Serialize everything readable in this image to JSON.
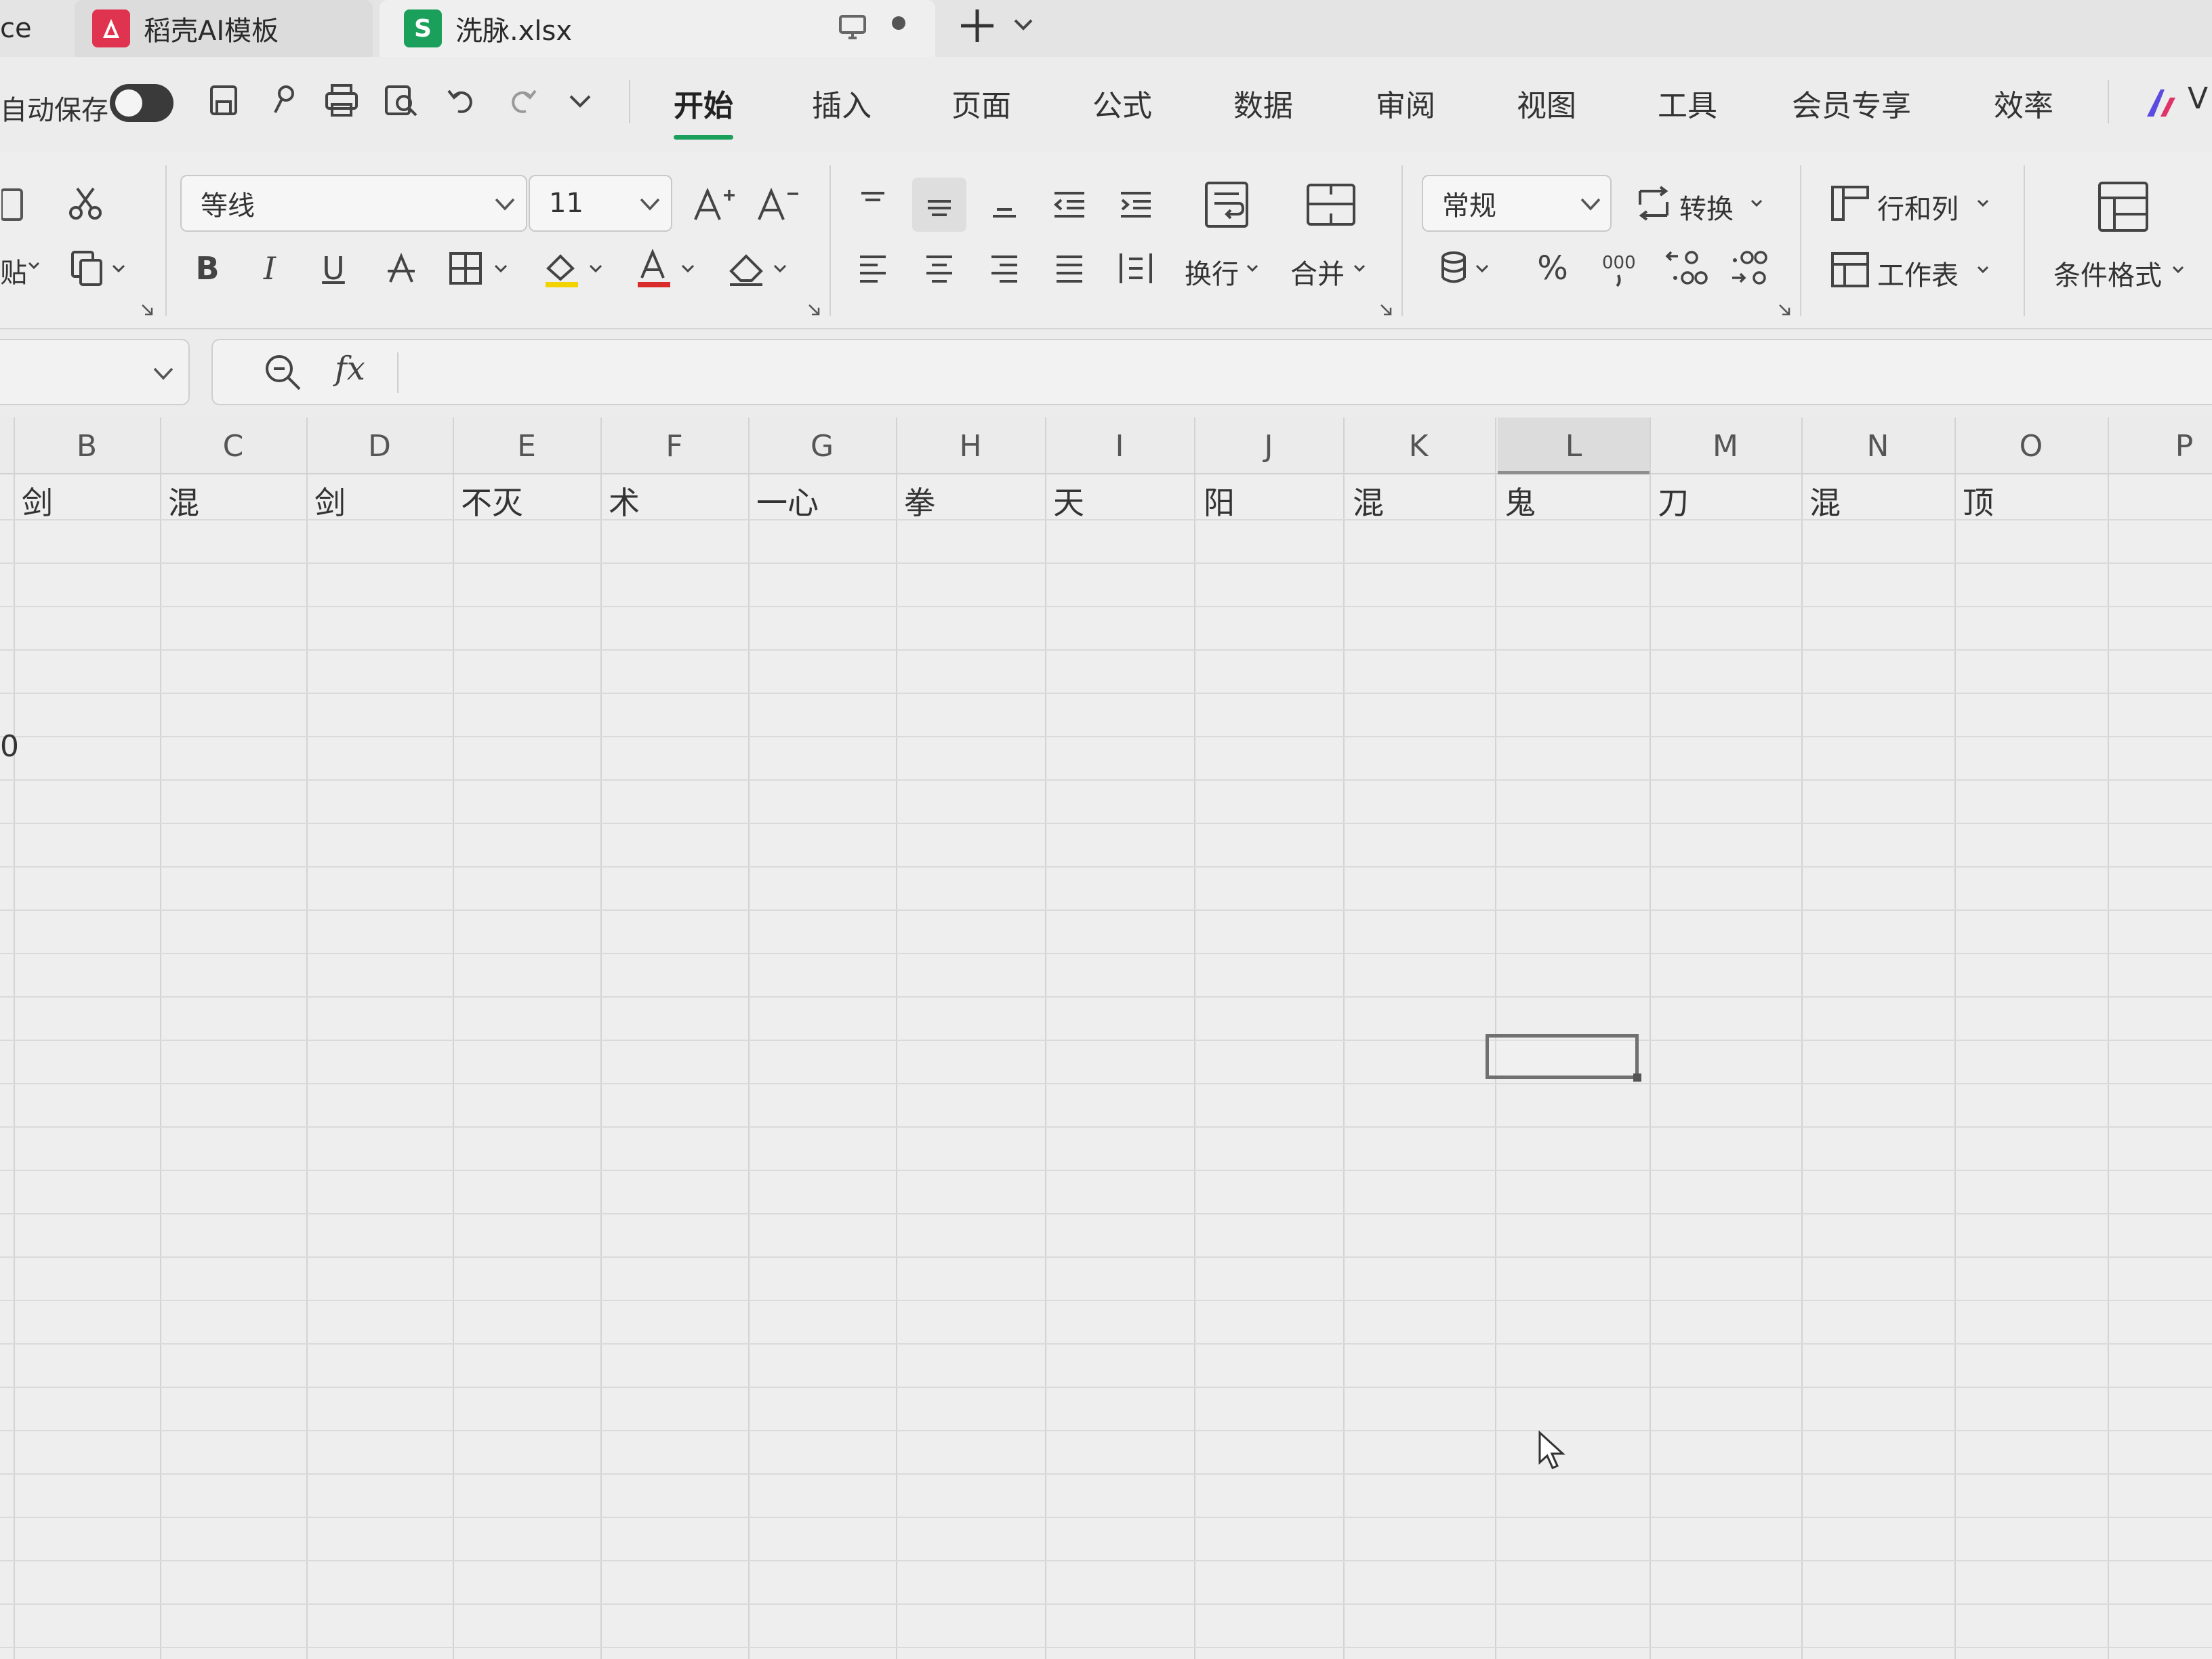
{
  "tabs": [
    {
      "label": "ce"
    },
    {
      "label": "稻壳AI模板",
      "icon": "docer-logo-icon",
      "color": "#e0334f"
    },
    {
      "label": "洗脉.xlsx",
      "icon": "spreadsheet-s-icon",
      "icon_text": "S",
      "color": "#1aa05a"
    }
  ],
  "autosave": {
    "label": "自动保存"
  },
  "menu": [
    "开始",
    "插入",
    "页面",
    "公式",
    "数据",
    "审阅",
    "视图",
    "工具",
    "会员专享",
    "效率"
  ],
  "active_menu": "开始",
  "menu_trailing": "V",
  "ribbon": {
    "paste_label": "贴",
    "font_name": "等线",
    "font_size": "11",
    "wrap_label": "换行",
    "merge_label": "合并",
    "number_format": "常规",
    "convert_label": "转换",
    "rows_cols_label": "行和列",
    "worksheet_label": "工作表",
    "cond_format_label": "条件格式",
    "bold": "B",
    "italic": "I",
    "underline": "U",
    "percent": "%",
    "thousands": "000"
  },
  "formula_bar": {
    "name_box": "",
    "fx": "fx"
  },
  "columns": [
    "B",
    "C",
    "D",
    "E",
    "F",
    "G",
    "H",
    "I",
    "J",
    "K",
    "L",
    "M",
    "N",
    "O",
    "P"
  ],
  "row1": [
    "剑",
    "混",
    "剑",
    "不灭",
    "术",
    "一心",
    "拳",
    "天",
    "阳",
    "混",
    "鬼",
    "刀",
    "混",
    "顶",
    ""
  ],
  "left_edge_value": "0",
  "selected_column": "L",
  "accent_color": "#1aa05a"
}
